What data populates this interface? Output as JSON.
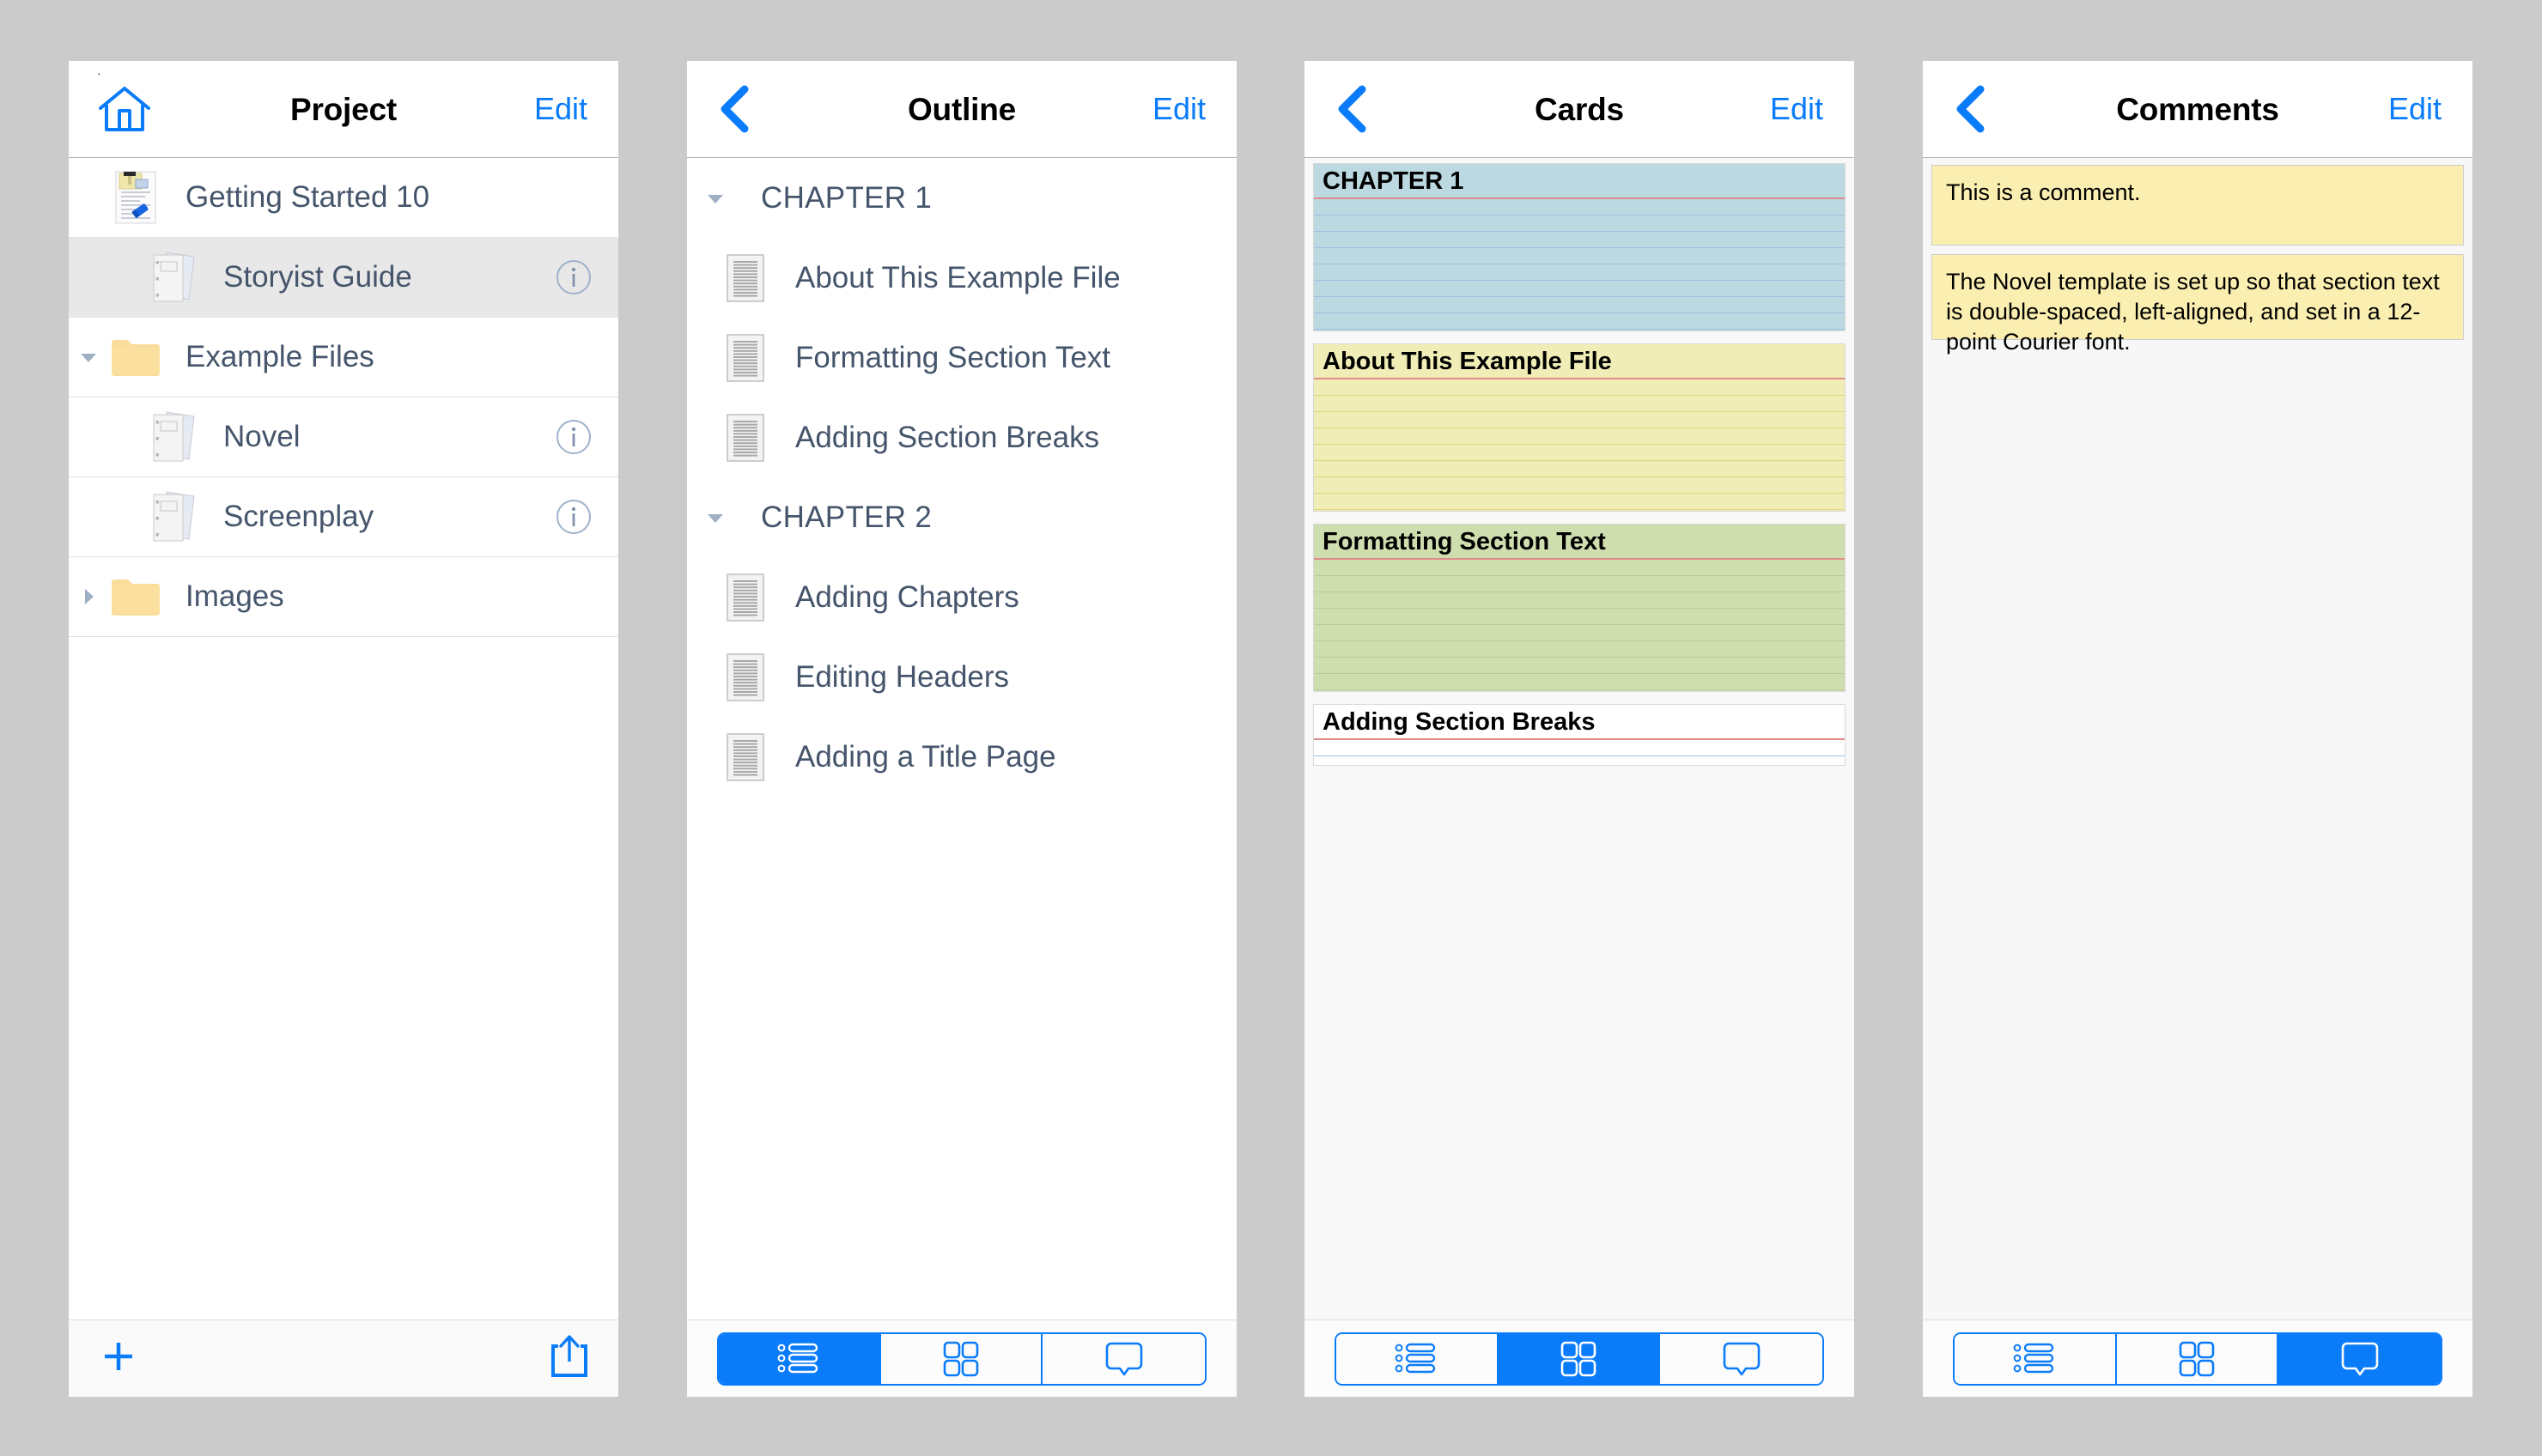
{
  "panels": {
    "project": {
      "title": "Project",
      "edit_label": "Edit",
      "home_icon": "home-icon",
      "tiny_mark": "'",
      "rows": [
        {
          "label": "Getting Started 10",
          "icon": "document-with-note-icon",
          "indent": 0,
          "twisty": "none",
          "info": false,
          "selected": false
        },
        {
          "label": "Storyist Guide",
          "icon": "manuscript-pages-icon",
          "indent": 1,
          "twisty": "none",
          "info": true,
          "selected": true
        },
        {
          "label": "Example Files",
          "icon": "folder-icon",
          "indent": 0,
          "twisty": "down",
          "info": false,
          "selected": false
        },
        {
          "label": "Novel",
          "icon": "manuscript-pages-icon",
          "indent": 1,
          "twisty": "none",
          "info": true,
          "selected": false
        },
        {
          "label": "Screenplay",
          "icon": "manuscript-pages-icon",
          "indent": 1,
          "twisty": "none",
          "info": true,
          "selected": false
        },
        {
          "label": "Images",
          "icon": "folder-icon",
          "indent": 0,
          "twisty": "right",
          "info": false,
          "selected": false
        }
      ],
      "toolbar": {
        "add_icon": "plus-icon",
        "share_icon": "share-icon"
      }
    },
    "outline": {
      "title": "Outline",
      "edit_label": "Edit",
      "back_icon": "chevron-left-icon",
      "rows": [
        {
          "label": "CHAPTER 1",
          "type": "chapter",
          "twisty": "down"
        },
        {
          "label": "About This Example File",
          "type": "item",
          "icon": "text-document-icon"
        },
        {
          "label": "Formatting Section Text",
          "type": "item",
          "icon": "text-document-icon"
        },
        {
          "label": "Adding Section Breaks",
          "type": "item",
          "icon": "text-document-icon"
        },
        {
          "label": "CHAPTER 2",
          "type": "chapter",
          "twisty": "down"
        },
        {
          "label": "Adding Chapters",
          "type": "item",
          "icon": "text-document-icon"
        },
        {
          "label": "Editing Headers",
          "type": "item",
          "icon": "text-document-icon"
        },
        {
          "label": "Adding a Title Page",
          "type": "item",
          "icon": "text-document-icon"
        }
      ],
      "segmented": {
        "active": 0
      }
    },
    "cards": {
      "title": "Cards",
      "edit_label": "Edit",
      "back_icon": "chevron-left-icon",
      "items": [
        {
          "title": "CHAPTER 1",
          "color": "#bcd9e2",
          "rule_color": "#9fbfe0",
          "height": 196,
          "rules": 9
        },
        {
          "title": "About This Example File",
          "color": "#f0eeb6",
          "rule_color": "#ddd47a",
          "height": 196,
          "rules": 9
        },
        {
          "title": "Formatting Section Text",
          "color": "#cfdeaf",
          "rule_color": "#b9cc94",
          "height": 196,
          "rules": 9
        },
        {
          "title": "Adding Section Breaks",
          "color": "#ffffff",
          "rule_color": "#9fbfe0",
          "height": 72,
          "rules": 3
        }
      ],
      "segmented": {
        "active": 1
      }
    },
    "comments": {
      "title": "Comments",
      "edit_label": "Edit",
      "back_icon": "chevron-left-icon",
      "items": [
        {
          "text": "This is a comment."
        },
        {
          "text": "The Novel template is set up so that section text is double-spaced, left-aligned, and set in a 12-point Courier font."
        }
      ],
      "segmented": {
        "active": 2
      }
    }
  },
  "segment_icons": [
    "list-icon",
    "grid-icon",
    "comment-bubble-icon"
  ],
  "colors": {
    "accent": "#0a7cfa",
    "label": "#45556b",
    "page_bg": "#cbcbcb",
    "selected_row": "#e8e8e8",
    "comment_yellow": "#faeeb0",
    "card_blue": "#bcd9e2",
    "card_yellow": "#f0eeb6",
    "card_green": "#cfdeaf",
    "card_white": "#ffffff",
    "card_title_rule": "#e08a8a"
  }
}
